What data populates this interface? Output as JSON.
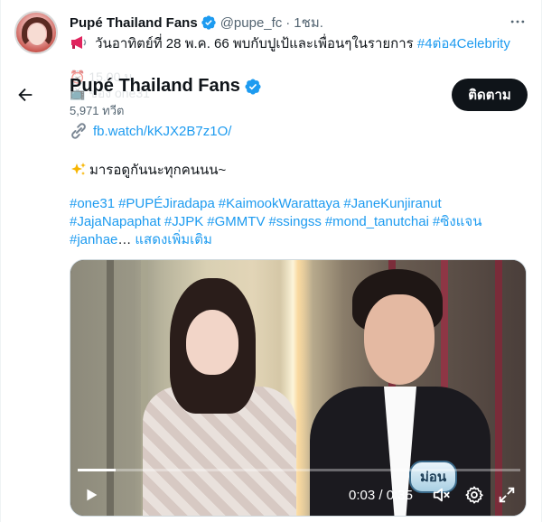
{
  "tweet": {
    "display_name": "Pupé Thailand Fans",
    "handle": "@pupe_fc",
    "separator": "·",
    "time_ago": "1ชม.",
    "line1_icon": "megaphone-icon",
    "line1_text": "วันอาทิตย์ที่ 28 พ.ค. 66  พบกับปูเป้และเพื่อนๆในรายการ ",
    "line1_hashtag": "#4ต่อ4Celebrity",
    "ghost_line1": "⏰ 15.00 น.",
    "ghost_line2": "📺 ช่อง one31"
  },
  "profile_card": {
    "name": "Pupé Thailand Fans",
    "tweet_count": "5,971 ทวีต",
    "follow_label": "ติดตาม"
  },
  "body": {
    "url_icon": "link-icon",
    "url": "fb.watch/kKJX2B7z1O/",
    "caption_icon": "sparkles-icon",
    "caption": "มารอดูกันนะทุกคนนน~",
    "hashtags": [
      "#one31",
      "#PUPÉJiradapa",
      "#KaimookWarattaya",
      "#JaneKunjiranut",
      "#JajaNapaphat",
      "#JJPK",
      "#GMMTV",
      "#ssingss",
      "#mond_tanutchai",
      "#ซิงแจน",
      "#janhae"
    ],
    "ellipsis": "…",
    "show_more": "แสดงเพิ่มเติม"
  },
  "video": {
    "name_tag": "ม่อน",
    "current_time": "0:03",
    "duration": "0:35",
    "time_separator": " / ",
    "progress_fraction": 0.086
  },
  "colors": {
    "link": "#1d9bf0",
    "text": "#0f1419",
    "muted": "#536471",
    "button_bg": "#0f1419"
  }
}
